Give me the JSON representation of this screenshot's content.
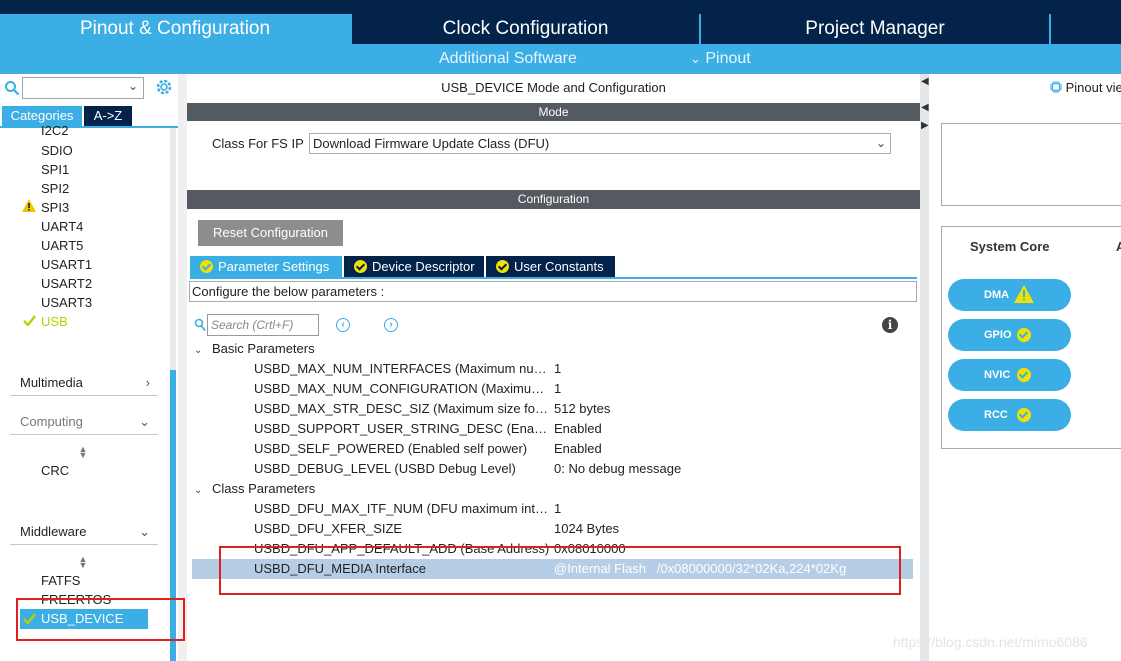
{
  "top_tabs": {
    "pinout": "Pinout & Configuration",
    "clock": "Clock Configuration",
    "project": "Project Manager"
  },
  "sub_menu": {
    "additional_software": "Additional Software",
    "pinout": "Pinout"
  },
  "left": {
    "categories_tab": "Categories",
    "az_tab": "A->Z",
    "connectivity_items": [
      "I2C2",
      "SDIO",
      "SPI1",
      "SPI2",
      "SPI3",
      "UART4",
      "UART5",
      "USART1",
      "USART2",
      "USART3",
      "USB"
    ],
    "multimedia": "Multimedia",
    "computing": "Computing",
    "computing_items": [
      "CRC"
    ],
    "middleware": "Middleware",
    "middleware_items": [
      "FATFS",
      "FREERTOS",
      "USB_DEVICE"
    ]
  },
  "center": {
    "title": "USB_DEVICE Mode and Configuration",
    "mode_header": "Mode",
    "class_label": "Class For FS IP",
    "class_value": "Download Firmware Update Class (DFU)",
    "config_header": "Configuration",
    "reset_button": "Reset Configuration",
    "tabs": [
      "Parameter Settings",
      "Device Descriptor",
      "User Constants"
    ],
    "hint": "Configure the below parameters :",
    "search_placeholder": "Search (Crtl+F)",
    "groups": [
      {
        "label": "Basic Parameters",
        "rows": [
          {
            "name": "USBD_MAX_NUM_INTERFACES (Maximum number of supported interfaces)",
            "value": "1"
          },
          {
            "name": "USBD_MAX_NUM_CONFIGURATION (Maximum number of supported configuration)",
            "value": "1"
          },
          {
            "name": "USBD_MAX_STR_DESC_SIZ (Maximum size for the string descriptors)",
            "value": "512 bytes"
          },
          {
            "name": "USBD_SUPPORT_USER_STRING_DESC (Enable user string support)",
            "value": "Enabled"
          },
          {
            "name": "USBD_SELF_POWERED (Enabled self power)",
            "value": "Enabled"
          },
          {
            "name": "USBD_DEBUG_LEVEL (USBD Debug Level)",
            "value": "0: No debug message"
          }
        ]
      },
      {
        "label": "Class Parameters",
        "rows": [
          {
            "name": "USBD_DFU_MAX_ITF_NUM (DFU maximum interface number)",
            "value": "1"
          },
          {
            "name": "USBD_DFU_XFER_SIZE",
            "value": "1024 Bytes"
          },
          {
            "name": "USBD_DFU_APP_DEFAULT_ADD (Base Address)",
            "value": "0x08010000"
          },
          {
            "name": "USBD_DFU_MEDIA Interface",
            "value": "@Internal Flash   /0x08000000/32*02Ka,224*02Kg"
          }
        ]
      }
    ]
  },
  "right": {
    "pinout_view": "Pinout vie",
    "system_core": "System Core",
    "system_core_extra": "A",
    "buttons": [
      "DMA",
      "GPIO",
      "NVIC",
      "RCC"
    ]
  },
  "watermark": "https://blog.csdn.net/mimo6086",
  "colors": {
    "accent": "#3caee6",
    "navy": "#03234b",
    "enabled": "#b8d200",
    "highlight": "#e02020"
  }
}
